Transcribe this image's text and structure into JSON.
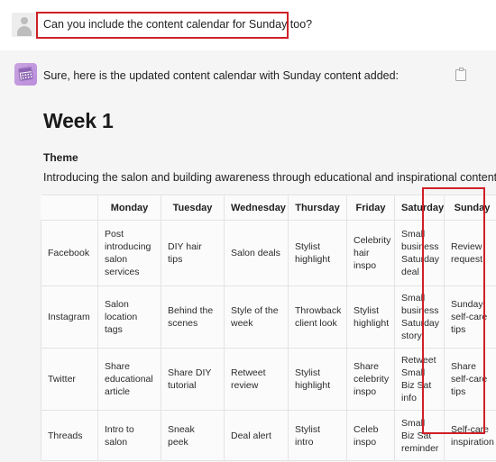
{
  "user_message": {
    "avatar_icon": "user-avatar-icon",
    "text": "Can you include the content calendar for Sunday too?",
    "highlight_color": "#cf2027"
  },
  "assistant_message": {
    "icon": "calendar-app-icon",
    "text": "Sure, here is the updated content calendar with Sunday content added:",
    "copy_icon": "clipboard-copy-icon",
    "heading": "Week 1",
    "theme_label": "Theme",
    "theme_text": "Introducing the salon and building awareness through educational and inspirational content.",
    "highlight_color": "#cf2027"
  },
  "table": {
    "corner_header": "",
    "headers": [
      "Monday",
      "Tuesday",
      "Wednesday",
      "Thursday",
      "Friday",
      "Saturday",
      "Sunday"
    ],
    "highlighted_column": "Sunday",
    "rows": [
      {
        "platform": "Facebook",
        "cells": [
          "Post introducing salon services",
          "DIY hair tips",
          "Salon deals",
          "Stylist highlight",
          "Celebrity hair inspo",
          "Small business Saturday deal",
          "Review request"
        ]
      },
      {
        "platform": "Instagram",
        "cells": [
          "Salon location tags",
          "Behind the scenes",
          "Style of the week",
          "Throwback client look",
          "Stylist highlight",
          "Small business Saturday story",
          "Sunday self-care tips"
        ]
      },
      {
        "platform": "Twitter",
        "cells": [
          "Share educational article",
          "Share DIY tutorial",
          "Retweet review",
          "Stylist highlight",
          "Share celebrity inspo",
          "Retweet Small Biz Sat info",
          "Share self-care tips"
        ]
      },
      {
        "platform": "Threads",
        "cells": [
          "Intro to salon",
          "Sneak peek",
          "Deal alert",
          "Stylist intro",
          "Celeb inspo",
          "Small Biz Sat reminder",
          "Self-care inspiration"
        ]
      }
    ]
  }
}
